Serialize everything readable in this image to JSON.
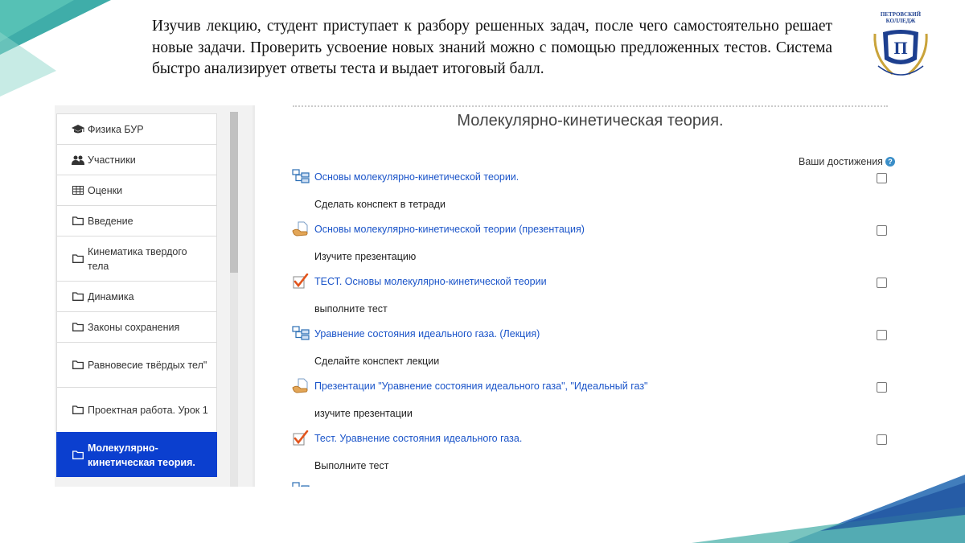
{
  "slide": {
    "paragraph": "Изучив   лекцию, студент приступает к разбору решенных задач, после чего самостоятельно решает новые задачи. Проверить усвоение новых знаний можно с помощью предложенных тестов.   Система быстро анализирует ответы теста  и выдает итоговый балл.",
    "logo_text": "ПЕТРОВСКИЙ КОЛЛЕДЖ"
  },
  "colors": {
    "active_bg": "#0b3fcf",
    "link": "#1a54c9",
    "accent_teal": "#2aa4a0",
    "accent_blue": "#2c6fb5"
  },
  "sidebar": {
    "items": [
      {
        "label": "Физика БУР",
        "icon": "graduation-cap-icon"
      },
      {
        "label": "Участники",
        "icon": "users-icon"
      },
      {
        "label": "Оценки",
        "icon": "table-icon"
      },
      {
        "label": "Введение",
        "icon": "folder-icon"
      },
      {
        "label": "Кинематика твердого тела",
        "icon": "folder-icon"
      },
      {
        "label": "Динамика",
        "icon": "folder-icon"
      },
      {
        "label": "Законы сохранения",
        "icon": "folder-icon"
      },
      {
        "label": "Равновесие твёрдых тел\"",
        "icon": "folder-icon"
      },
      {
        "label": "Проектная работа. Урок 1",
        "icon": "folder-icon"
      },
      {
        "label": "Молекулярно-кинетическая теория.",
        "icon": "folder-icon",
        "active": true
      }
    ]
  },
  "main": {
    "section_title": "Молекулярно-кинетическая теория.",
    "achievements_label": "Ваши достижения",
    "activities": [
      {
        "title": "Основы молекулярно-кинетической теории.",
        "icon": "book-icon",
        "description": "Сделать конспект в тетради"
      },
      {
        "title": "Основы молекулярно-кинетической теории (презентация)",
        "icon": "file-icon",
        "description": "Изучите презентацию"
      },
      {
        "title": "ТЕСТ. Основы молекулярно-кинетической теории",
        "icon": "quiz-icon",
        "description": "выполните тест"
      },
      {
        "title": "Уравнение состояния идеального газа. (Лекция)",
        "icon": "book-icon",
        "description": "Сделайте конспект лекции"
      },
      {
        "title": "Презентации \"Уравнение состояния идеального газа\", \"Идеальный газ\"",
        "icon": "file-icon",
        "description": "изучите презентации"
      },
      {
        "title": "Тест. Уравнение состояния идеального газа.",
        "icon": "quiz-icon",
        "description": "Выполните тест"
      }
    ]
  }
}
